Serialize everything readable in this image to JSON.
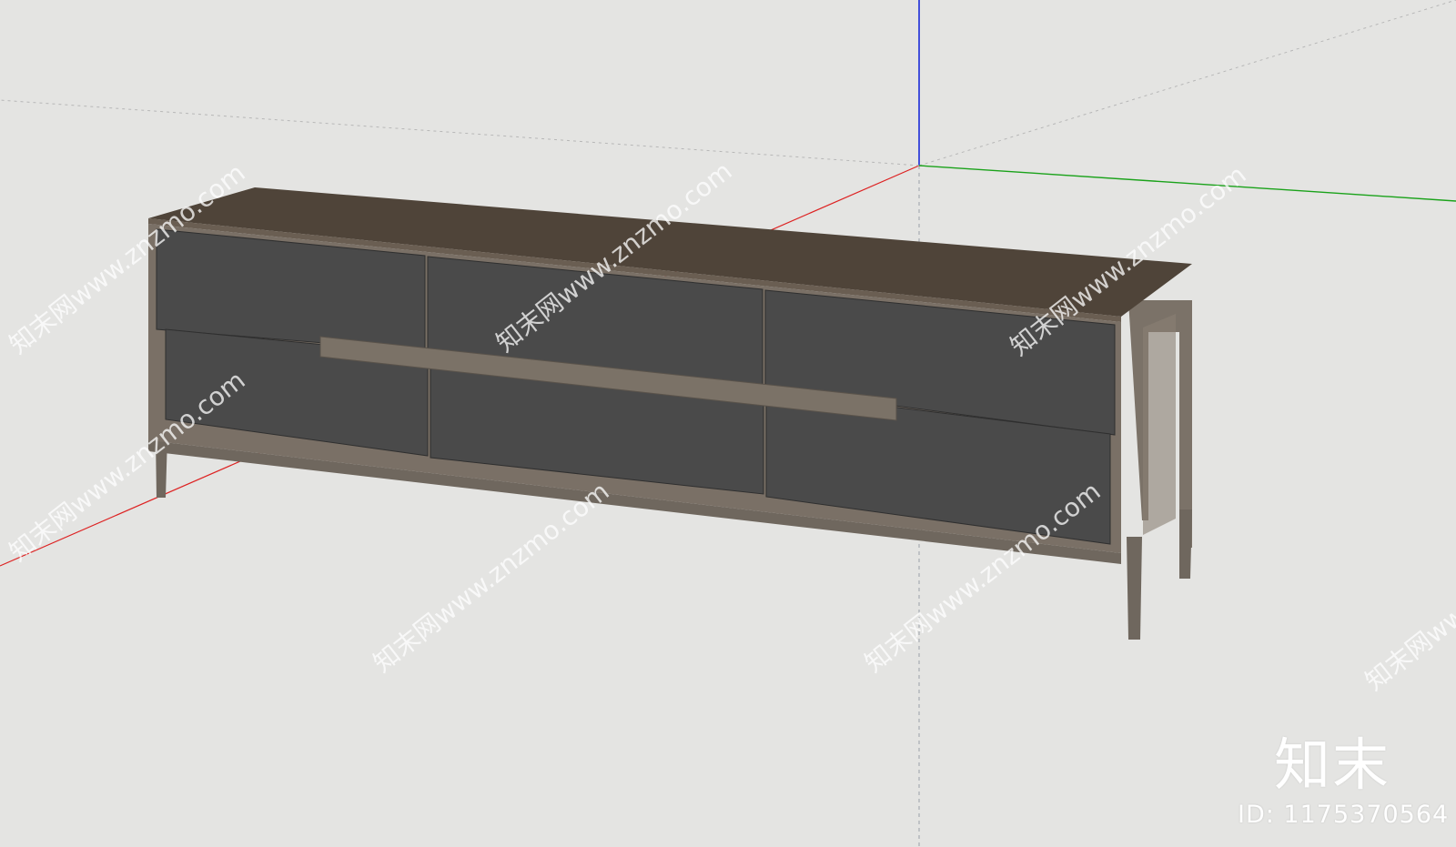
{
  "app": {
    "viewport": "sketchup-3d-viewport",
    "axis_colors": {
      "x": "#d22",
      "y": "#1aa21a",
      "z": "#1b2bd8"
    },
    "background": "#e4e4e2"
  },
  "model": {
    "object": "tv-cabinet",
    "colors": {
      "frame": "#7a7066",
      "top": "#4f4439",
      "drawer": "#4a4a4a",
      "drawer_edge": "#2f2f2f",
      "handle": "#7b7267"
    },
    "drawers": 6
  },
  "watermarks": {
    "tiled_text": "知末网www.znzmo.com",
    "logo_text": "知末",
    "id_text": "ID: 1175370564"
  }
}
